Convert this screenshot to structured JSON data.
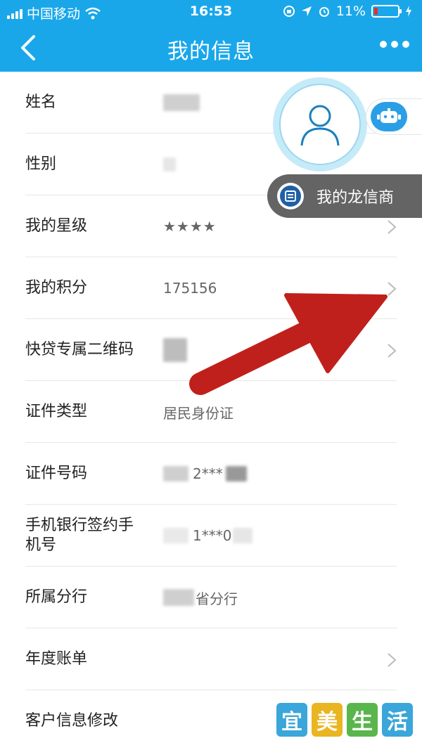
{
  "status_bar": {
    "carrier": "中国移动",
    "time": "16:53",
    "battery": "11%"
  },
  "nav": {
    "title": "我的信息",
    "back_icon": "chevron-left-icon",
    "more_icon": "more-dots-icon"
  },
  "rows": [
    {
      "label": "姓名",
      "value": ""
    },
    {
      "label": "性别",
      "value": ""
    },
    {
      "label": "我的星级",
      "value": "★★★★"
    },
    {
      "label": "我的积分",
      "value": "175156"
    },
    {
      "label": "快贷专属二维码",
      "value": ""
    },
    {
      "label": "证件类型",
      "value": "居民身份证"
    },
    {
      "label": "证件号码",
      "value": "2***"
    },
    {
      "label": "手机银行签约手机号",
      "value": "1***0"
    },
    {
      "label": "所属分行",
      "value": "省分行"
    },
    {
      "label": "年度账单",
      "value": ""
    },
    {
      "label": "客户信息修改",
      "value": ""
    }
  ],
  "star_rating": 4,
  "floating": {
    "pill_text": "我的龙信商",
    "avatar_icon": "user-icon",
    "robot_icon": "robot-icon",
    "logo_icon": "long-xin-logo-icon"
  },
  "watermark": [
    "宜",
    "美",
    "生",
    "活"
  ],
  "colors": {
    "brand_blue": "#19a7ea",
    "star_gold": "#f5c02a",
    "arrow_red": "#c0201b",
    "pill_gray": "#646464"
  }
}
